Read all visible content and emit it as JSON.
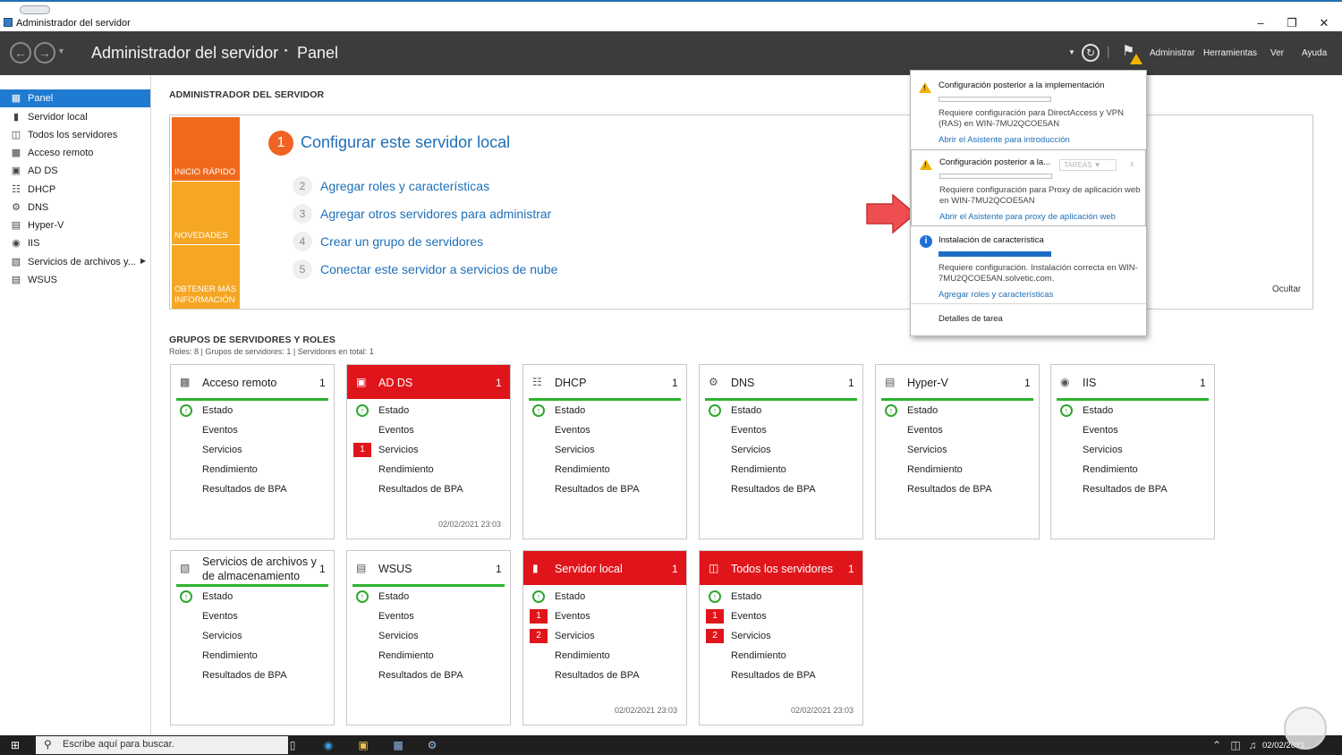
{
  "window": {
    "title": "Administrador del servidor"
  },
  "header": {
    "crumb_root": "Administrador del servidor",
    "crumb_sep": "‣",
    "crumb_current": "Panel",
    "menus": [
      "Administrar",
      "Herramientas",
      "Ver",
      "Ayuda"
    ]
  },
  "nav": {
    "items": [
      {
        "label": "Panel",
        "icon": "dashboard-icon"
      },
      {
        "label": "Servidor local",
        "icon": "server-icon"
      },
      {
        "label": "Todos los servidores",
        "icon": "servers-icon"
      },
      {
        "label": "Acceso remoto",
        "icon": "remote-access-icon"
      },
      {
        "label": "AD DS",
        "icon": "ad-ds-icon"
      },
      {
        "label": "DHCP",
        "icon": "dhcp-icon"
      },
      {
        "label": "DNS",
        "icon": "dns-icon"
      },
      {
        "label": "Hyper-V",
        "icon": "hyper-v-icon"
      },
      {
        "label": "IIS",
        "icon": "iis-icon"
      },
      {
        "label": "Servicios de archivos y...",
        "icon": "file-services-icon"
      },
      {
        "label": "WSUS",
        "icon": "wsus-icon"
      }
    ]
  },
  "welcome": {
    "title": "ADMINISTRADOR DEL SERVIDOR",
    "sidebar": [
      "INICIO RÁPIDO",
      "NOVEDADES",
      "OBTENER MÁS INFORMACIÓN"
    ],
    "step1_num": "1",
    "step1_label": "Configurar este servidor local",
    "steps": [
      {
        "num": "2",
        "label": "Agregar roles y características"
      },
      {
        "num": "3",
        "label": "Agregar otros servidores para administrar"
      },
      {
        "num": "4",
        "label": "Crear un grupo de servidores"
      },
      {
        "num": "5",
        "label": "Conectar este servidor a servicios de nube"
      }
    ],
    "hide": "Ocultar"
  },
  "groups": {
    "title": "GRUPOS DE SERVIDORES Y ROLES",
    "stats": "Roles: 8   |   Grupos de servidores: 1   |   Servidores en total: 1"
  },
  "tile_rows": [
    "Estado",
    "Eventos",
    "Servicios",
    "Rendimiento",
    "Resultados de BPA"
  ],
  "tiles": [
    {
      "name": "Acceso remoto",
      "count": "1",
      "alert": false,
      "badges": {},
      "timestamp": ""
    },
    {
      "name": "AD DS",
      "count": "1",
      "alert": true,
      "badges": {
        "servicios": "1"
      },
      "timestamp": "02/02/2021 23:03"
    },
    {
      "name": "DHCP",
      "count": "1",
      "alert": false,
      "badges": {},
      "timestamp": ""
    },
    {
      "name": "DNS",
      "count": "1",
      "alert": false,
      "badges": {},
      "timestamp": ""
    },
    {
      "name": "Hyper-V",
      "count": "1",
      "alert": false,
      "badges": {},
      "timestamp": ""
    },
    {
      "name": "IIS",
      "count": "1",
      "alert": false,
      "badges": {},
      "timestamp": ""
    },
    {
      "name": "Servicios de archivos y de almacenamiento",
      "count": "1",
      "alert": false,
      "badges": {},
      "timestamp": ""
    },
    {
      "name": "WSUS",
      "count": "1",
      "alert": false,
      "badges": {},
      "timestamp": ""
    },
    {
      "name": "Servidor local",
      "count": "1",
      "alert": true,
      "badges": {
        "eventos": "1",
        "servicios": "2"
      },
      "timestamp": "02/02/2021 23:03"
    },
    {
      "name": "Todos los servidores",
      "count": "1",
      "alert": true,
      "badges": {
        "eventos": "1",
        "servicios": "2"
      },
      "timestamp": "02/02/2021 23:03"
    }
  ],
  "notifications": {
    "items": [
      {
        "title": "Configuración posterior a la implementación",
        "desc": "Requiere configuración para DirectAccess y VPN (RAS) en WIN-7MU2QCOE5AN",
        "link": "Abrir el Asistente para introducción"
      },
      {
        "title": "Configuración posterior a la...",
        "tasks": "TAREAS",
        "close": "x",
        "desc": "Requiere configuración para Proxy de aplicación web en WIN-7MU2QCOE5AN",
        "link": "Abrir el Asistente para proxy de aplicación web"
      },
      {
        "title": "Instalación de característica",
        "desc": "Requiere configuración. Instalación correcta en WIN-7MU2QCOE5AN.solvetic.com.",
        "link": "Agregar roles y características"
      }
    ],
    "details": "Detalles de tarea"
  },
  "taskbar": {
    "search_placeholder": "Escribe aquí para buscar.",
    "date": "02/02/2021"
  },
  "colors": {
    "header_bg": "#3c3c3c",
    "accent_blue": "#1f7ad1",
    "alert_red": "#e0151b",
    "ok_green": "#2fb22f",
    "quick_start_orange": "#f0691c",
    "news_orange": "#f5a623",
    "link_blue": "#1e6fb8"
  }
}
